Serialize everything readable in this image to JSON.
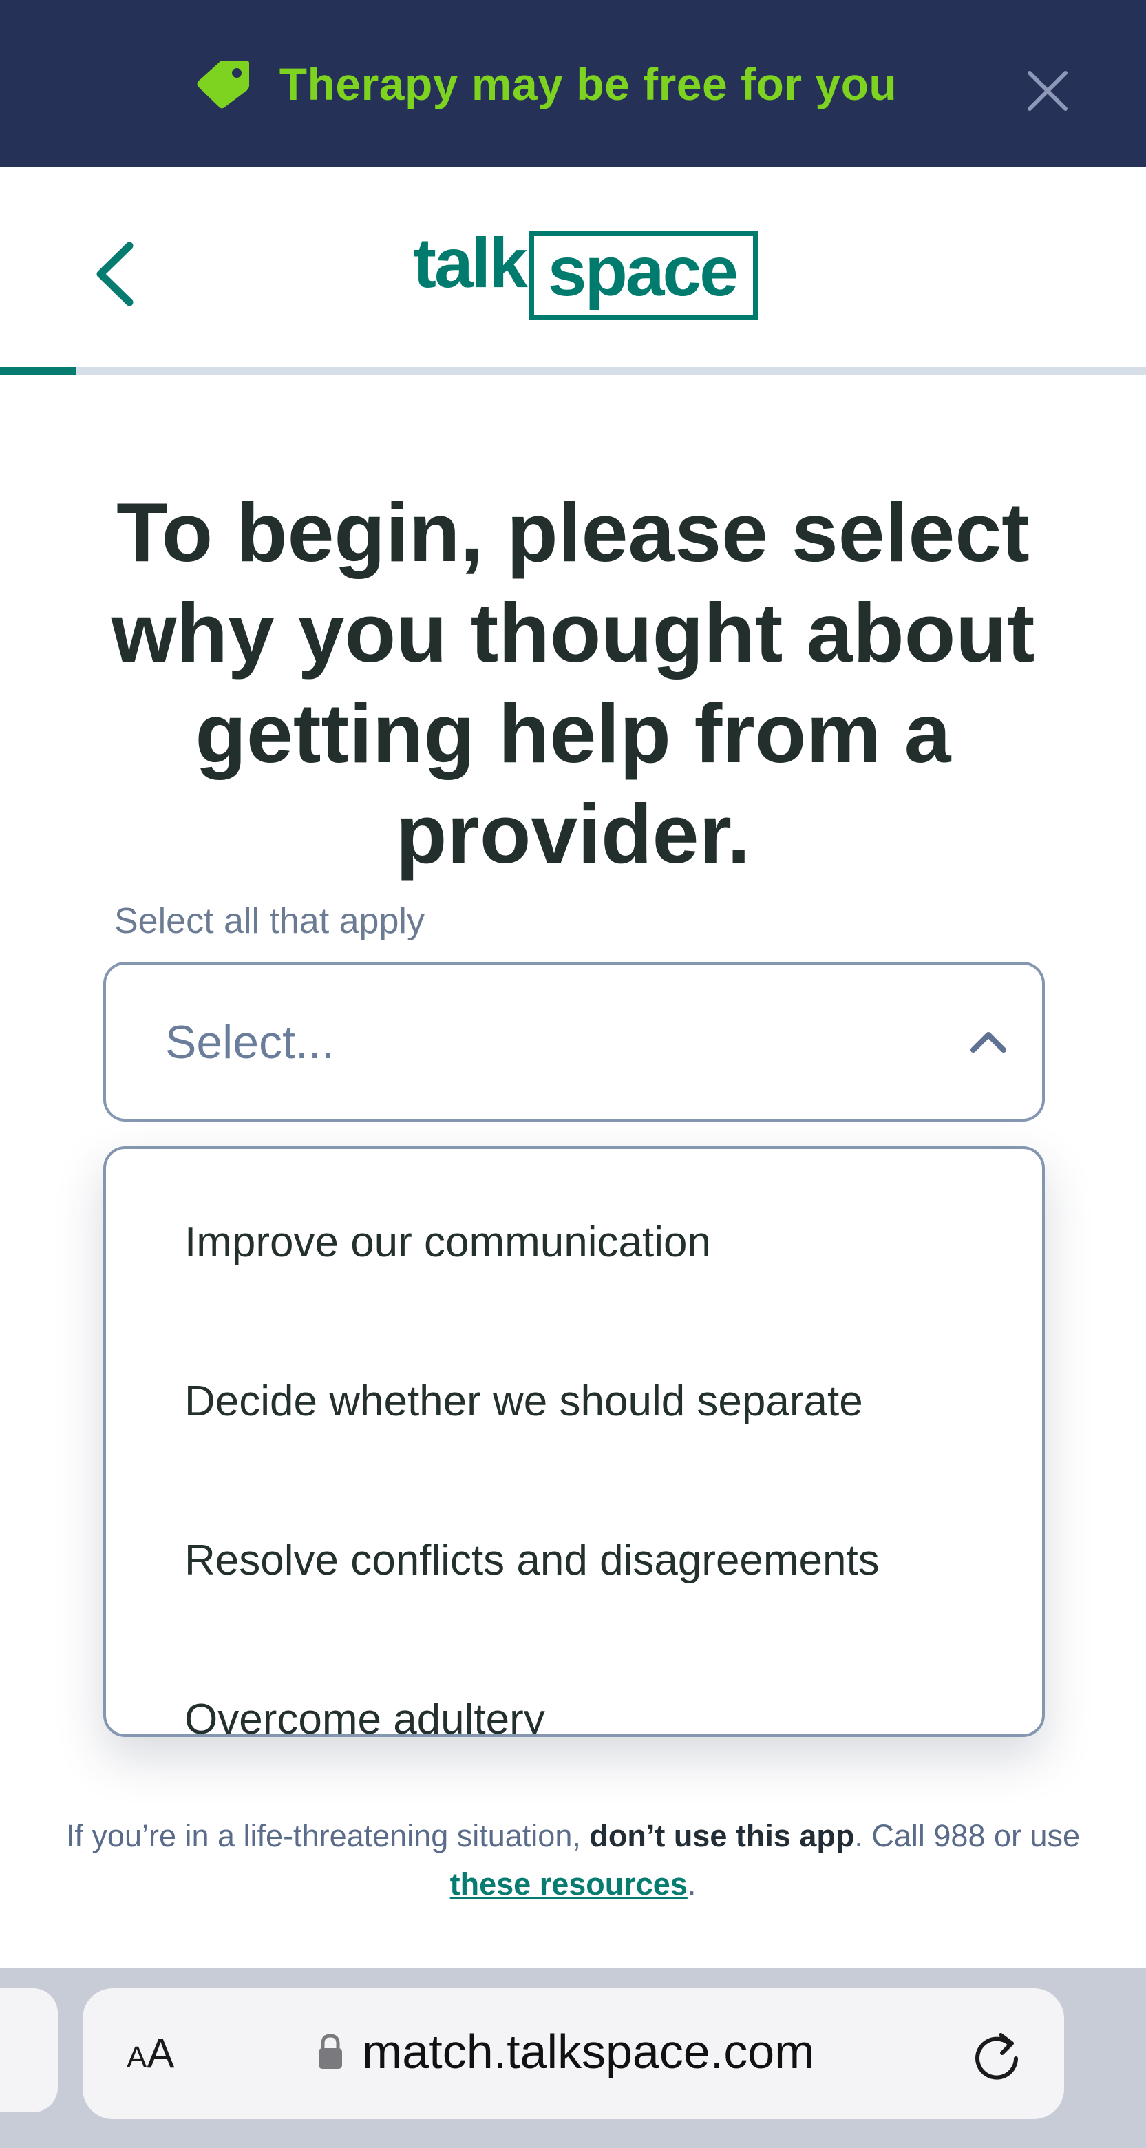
{
  "banner": {
    "text": "Therapy may be free for you",
    "icon": "tag-icon",
    "close_icon": "close-icon",
    "background_color": "#263158",
    "text_color": "#7ed321"
  },
  "header": {
    "back_icon": "chevron-left-icon",
    "logo_left": "talk",
    "logo_right": "space",
    "brand_color": "#007b6e"
  },
  "progress": {
    "fraction": 0.066
  },
  "page": {
    "title": "To begin, please select why you thought about getting help from a provider.",
    "hint": "Select all that apply"
  },
  "select": {
    "placeholder": "Select...",
    "icon": "chevron-up-icon",
    "options": [
      "Improve our communication",
      "Decide whether we should separate",
      "Resolve conflicts and disagreements",
      "Overcome adultery"
    ]
  },
  "disclaimer": {
    "prefix": "If you’re in a life-threatening situation, ",
    "bold": "don’t use this app",
    "middle": ". Call 988 or use ",
    "link": "these resources",
    "suffix": "."
  },
  "browser": {
    "text_size_label": "AA",
    "url": "match.talkspace.com",
    "lock_icon": "lock-icon",
    "reload_icon": "reload-icon"
  }
}
